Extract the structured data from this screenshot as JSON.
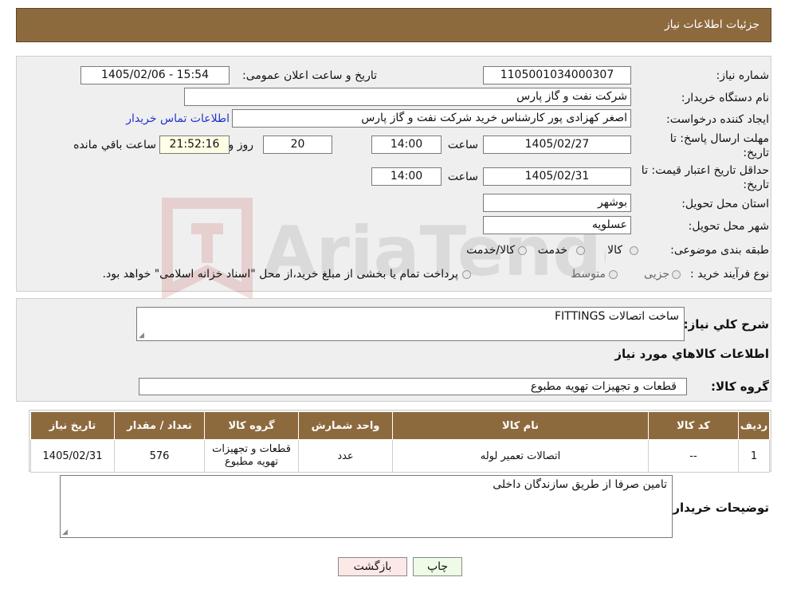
{
  "header": {
    "title": "جزئیات اطلاعات نیاز"
  },
  "form": {
    "need_number_label": "شماره نیاز:",
    "need_number": "1105001034000307",
    "announce_label": "تاریخ و ساعت اعلان عمومی:",
    "announce_value": "1405/02/06 - 15:54",
    "buyer_org_label": "نام دستگاه خریدار:",
    "buyer_org": "شرکت نفت و گاز پارس",
    "requester_label": "ایجاد کننده درخواست:",
    "requester": "اصغر کهزادی پور کارشناس خرید شرکت نفت و گاز پارس",
    "contact_link": "اطلاعات تماس خریدار",
    "deadline_label_1": "مهلت ارسال پاسخ: تا",
    "deadline_label_2": "تاریخ:",
    "deadline_date": "1405/02/27",
    "time_label": "ساعت",
    "deadline_time": "14:00",
    "days_value": "20",
    "days_label": "روز و",
    "remaining_time": "21:52:16",
    "remaining_label": "ساعت باقي مانده",
    "validity_label_1": "حداقل تاریخ اعتبار قیمت: تا",
    "validity_label_2": "تاریخ:",
    "validity_date": "1405/02/31",
    "validity_time_label": "ساعت",
    "validity_time": "14:00",
    "province_label": "استان محل تحویل:",
    "province": "بوشهر",
    "city_label": "شهر محل تحویل:",
    "city": "عسلویه",
    "category_label": "طبقه بندی موضوعی:",
    "category_options": [
      "کالا",
      "خدمت",
      "کالا/خدمت"
    ],
    "process_label": "نوع فرآیند خرید :",
    "process_options": [
      "جزیی",
      "متوسط"
    ],
    "process_note": "پرداخت تمام یا بخشی از مبلغ خرید،از محل \"اسناد خزانه اسلامی\" خواهد بود."
  },
  "summary": {
    "desc_label": "شرح کلي نياز:",
    "desc_value": "ساخت اتصالات FITTINGS",
    "items_heading": "اطلاعات کالاهاي مورد نياز",
    "group_label": "گروه کالا:",
    "group_value": "قطعات و تجهیزات تهویه مطبوع"
  },
  "table": {
    "headers": [
      "رديف",
      "کد کالا",
      "نام کالا",
      "واحد شمارش",
      "گروه کالا",
      "تعداد / مقدار",
      "تاریخ نیاز"
    ],
    "rows": [
      [
        "1",
        "--",
        "اتصالات تعمیر لوله",
        "عدد",
        "قطعات و تجهیزات تهویه مطبوع",
        "576",
        "1405/02/31"
      ]
    ]
  },
  "buyer_notes": {
    "label": "توضیحات خریدار:",
    "value": "تامین صرفا از طریق سازندگان داخلی"
  },
  "buttons": {
    "print": "چاپ",
    "back": "بازگشت"
  },
  "watermark": {
    "text": "AriaTender.neT"
  }
}
